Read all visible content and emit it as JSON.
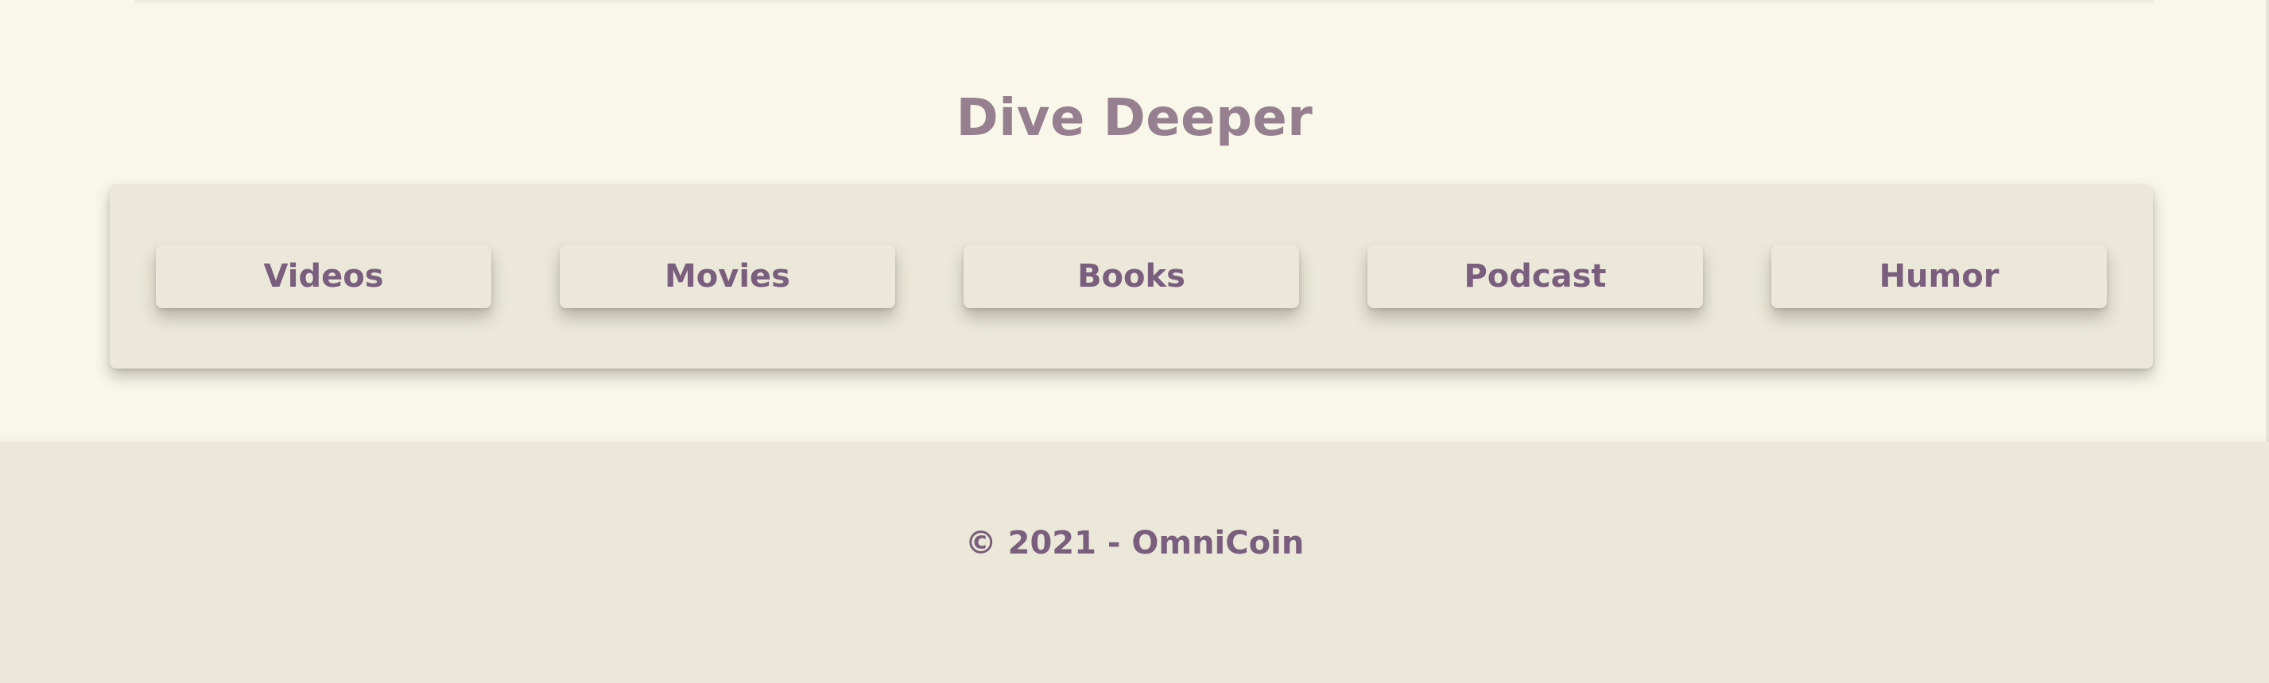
{
  "section": {
    "title": "Dive Deeper"
  },
  "nav": {
    "items": [
      {
        "label": "Videos"
      },
      {
        "label": "Movies"
      },
      {
        "label": "Books"
      },
      {
        "label": "Podcast"
      },
      {
        "label": "Humor"
      }
    ]
  },
  "footer": {
    "copyright": "© 2021 - OmniCoin"
  },
  "colors": {
    "page_background": "#f9f7ea",
    "panel_background": "#ebe8d9",
    "title_text": "#96808f",
    "button_text": "#7a5e7d"
  }
}
